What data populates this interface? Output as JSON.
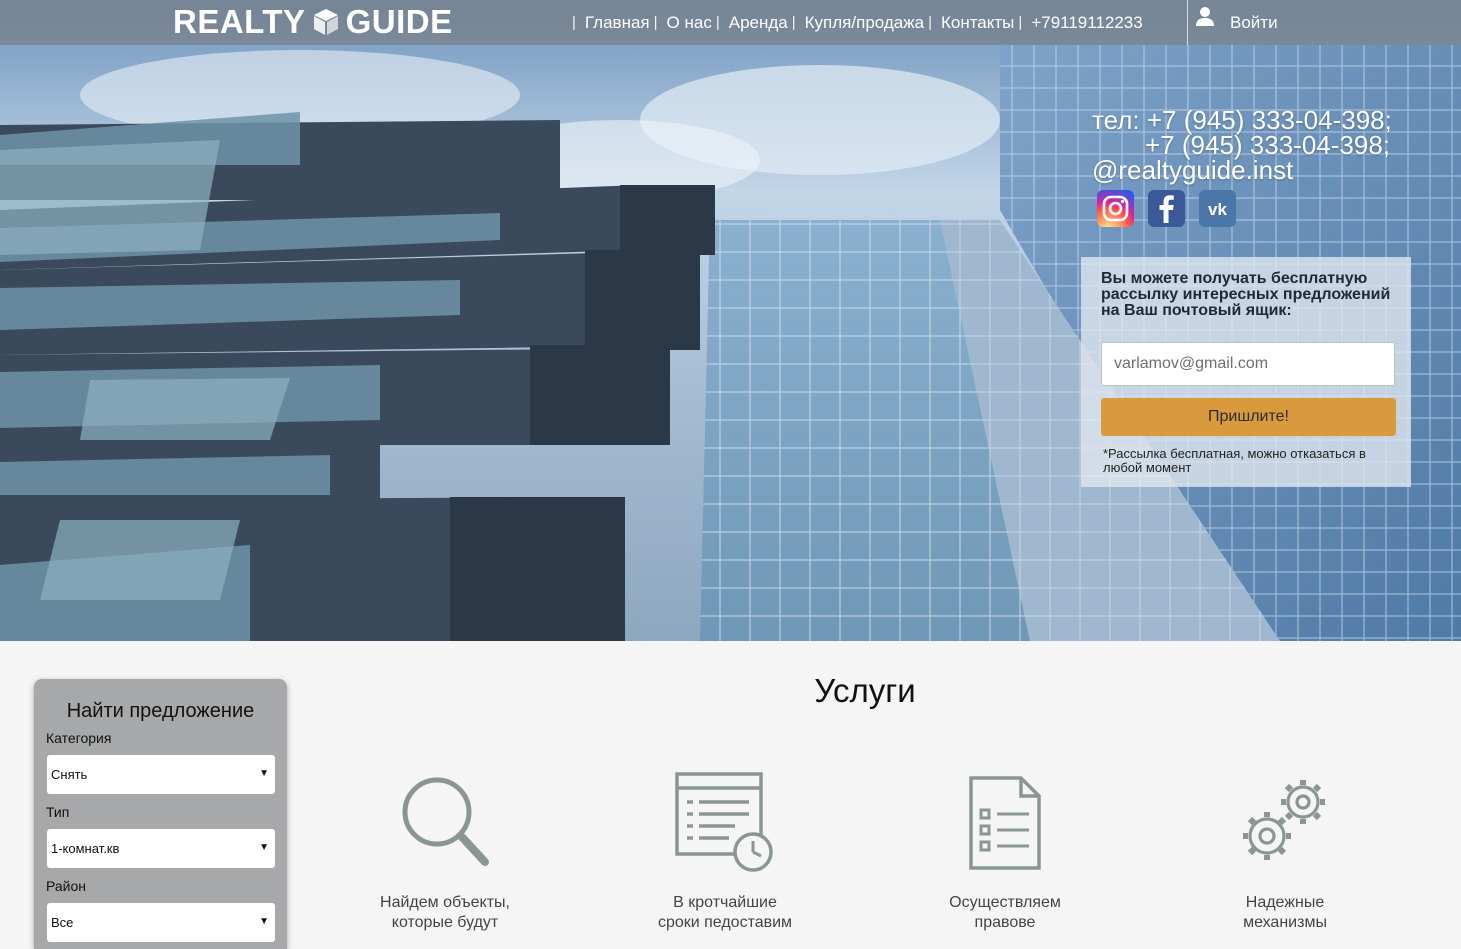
{
  "brand": {
    "logo_left": "REALTY",
    "logo_right": "GUIDE"
  },
  "nav": {
    "items": [
      "Главная",
      "О нас",
      "Аренда",
      "Купля/продажа",
      "Контакты",
      "+79119112233"
    ],
    "login_label": "Войти"
  },
  "contacts": {
    "line1": "тел: +7 (945) 333-04-398;",
    "line2": "+7 (945) 333-04-398;",
    "line3": "@realtyguide.inst",
    "socials": [
      "instagram-icon",
      "facebook-icon",
      "vk-icon"
    ]
  },
  "newsletter": {
    "title": "Вы можете получать бесплатную рассылку интересных предложений на Ваш почтовый ящик:",
    "placeholder": "varlamov@gmail.com",
    "button_label": "Пришлите!",
    "note": "*Рассылка бесплатная, можно отказаться в любой момент",
    "button_color": "#d99a3d"
  },
  "finder": {
    "title": "Найти предложение",
    "fields": [
      {
        "label": "Категория",
        "value": "Снять"
      },
      {
        "label": "Тип",
        "value": "1-комнат.кв"
      },
      {
        "label": "Район",
        "value": "Все"
      }
    ]
  },
  "services": {
    "title": "Услуги",
    "items": [
      {
        "icon": "search-icon",
        "line1": "Найдем объекты,",
        "line2": "которые будут"
      },
      {
        "icon": "list-clock-icon",
        "line1": "В кротчайшие",
        "line2": "сроки педоставим"
      },
      {
        "icon": "document-list-icon",
        "line1": "Осуществляем",
        "line2": "правове"
      },
      {
        "icon": "gears-icon",
        "line1": "Надежные",
        "line2": "механизмы"
      }
    ]
  }
}
